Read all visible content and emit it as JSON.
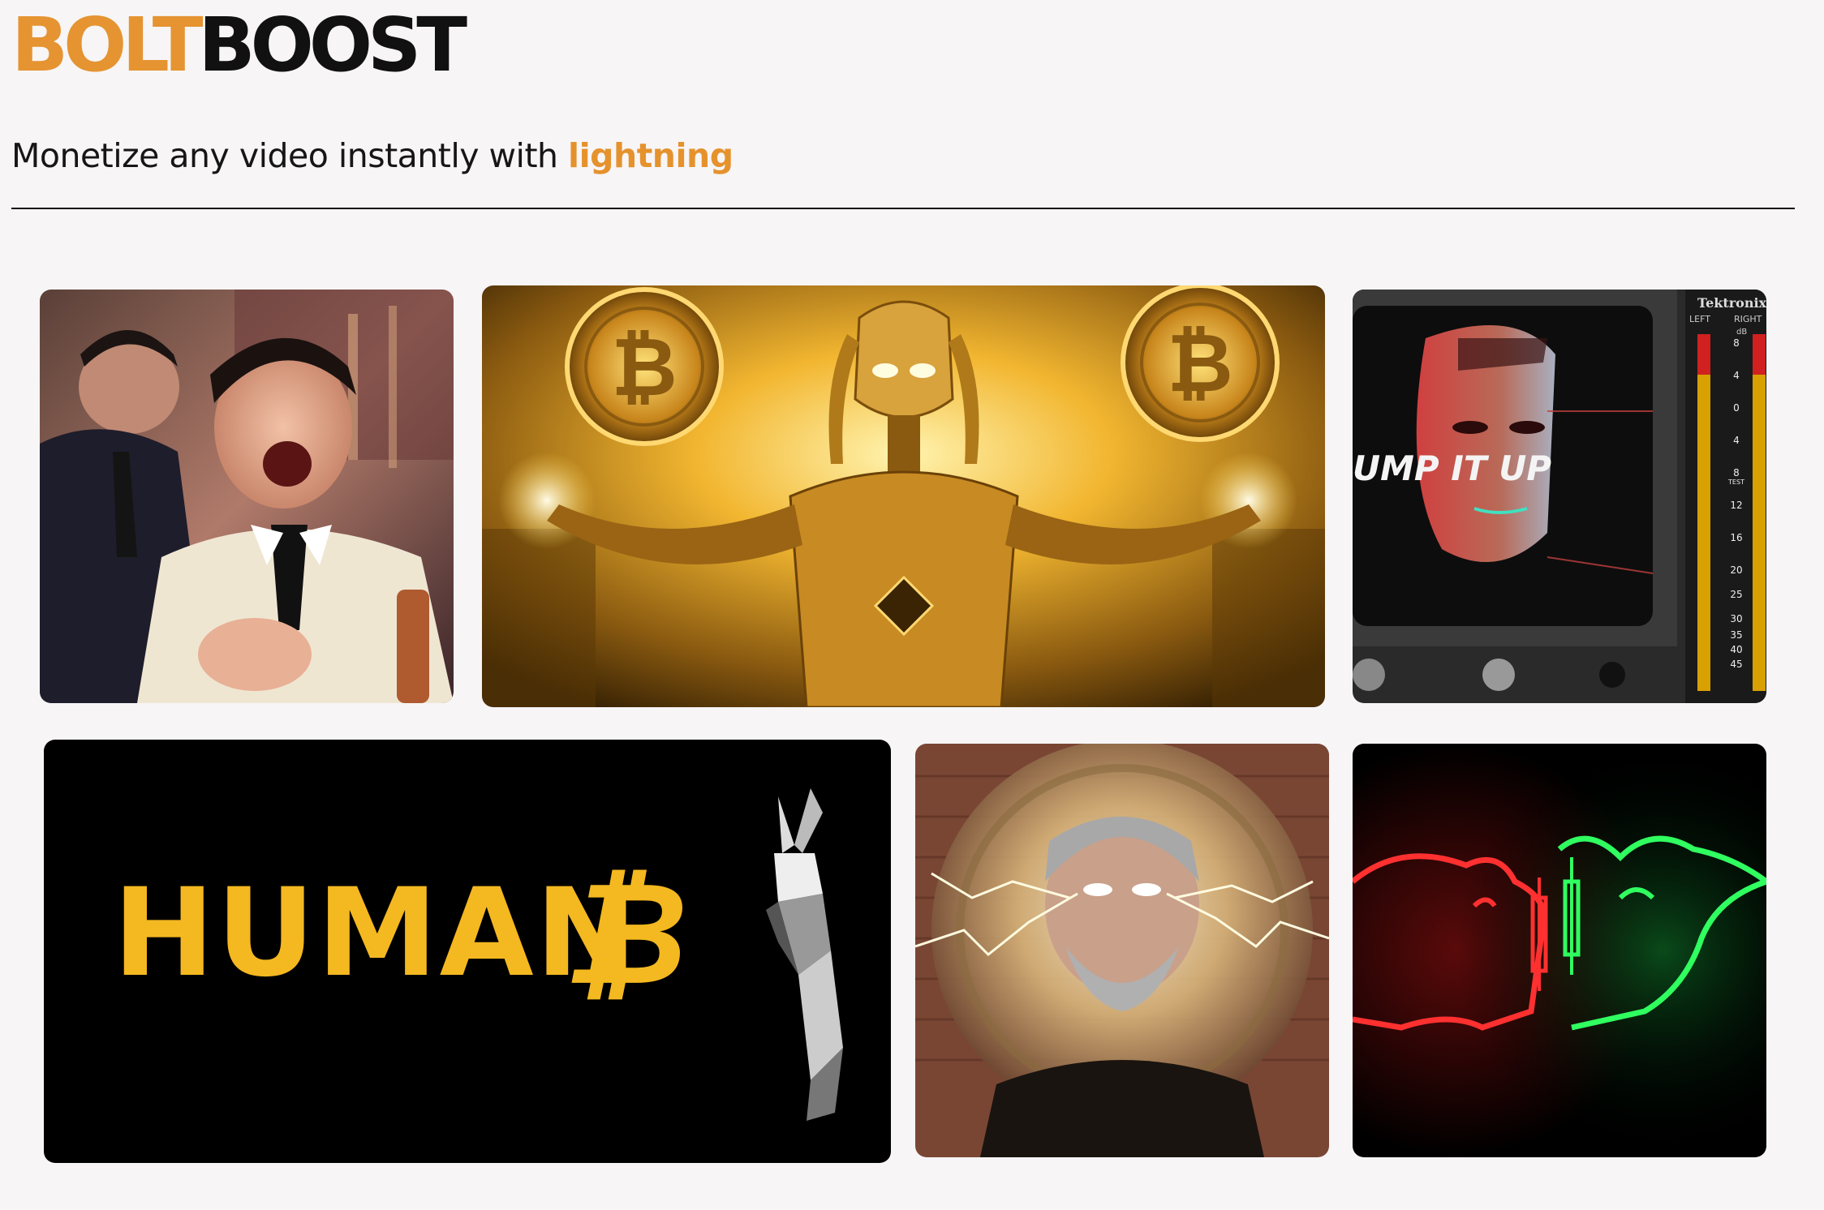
{
  "brand": {
    "part1": "BOLT",
    "part2": "BOOST",
    "accent": "#e59431"
  },
  "tagline": {
    "prefix": "Monetize any video instantly with ",
    "highlight": "lightning"
  },
  "videos": [
    {
      "title": "Laughing men (Goodfellas meme)"
    },
    {
      "title": "Golden robot with bitcoins"
    },
    {
      "title": "Pump it up",
      "overlay": "UMP IT UP",
      "brand": "Tektronix",
      "channels": [
        "LEFT",
        "RIGHT"
      ],
      "unit": "dB",
      "scale": [
        "8",
        "4",
        "0",
        "4",
        "8",
        "12",
        "16",
        "20",
        "25",
        "30",
        "35",
        "40",
        "45"
      ],
      "test_label": "TEST"
    },
    {
      "title": "Human B",
      "text": "HUMAN",
      "symbol": "₿"
    },
    {
      "title": "Man with glowing eyes and lightning"
    },
    {
      "title": "Neon bull vs bear"
    }
  ]
}
